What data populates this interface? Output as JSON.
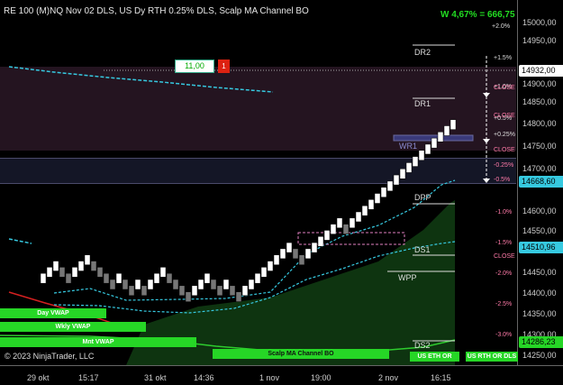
{
  "header": {
    "title": "RE 100 (M)NQ Nov 02 DLS, US Dy RTH 0.25% DLS, Scalp MA Channel BO",
    "pnl": "W 4,67% = 666,75"
  },
  "order": {
    "price": "11,00",
    "quantity": "1"
  },
  "price_axis": {
    "ticks": [
      "15000,00",
      "14950,00",
      "14900,00",
      "14850,00",
      "14800,00",
      "14750,00",
      "14700,00",
      "14650,00",
      "14600,00",
      "14550,00",
      "14500,00",
      "14450,00",
      "14400,00",
      "14350,00",
      "14300,00",
      "14250,00"
    ],
    "last_price": "14932,00",
    "box_1": "14668,60",
    "box_2": "14510,96",
    "box_3": "14286,23"
  },
  "percent_scale": {
    "upper": [
      "+2.0%",
      "+1.5%",
      "+1.0%",
      "+0.5%",
      "+0.25%",
      "-0.25%",
      "-0.5%"
    ],
    "lower": [
      "-1.0%",
      "-1.5%",
      "-2.0%",
      "-2.5%",
      "-3.0%"
    ],
    "close_label": "CLOSE"
  },
  "levels": {
    "dr2": "DR2",
    "dr1": "DR1",
    "wr1": "WR1",
    "dpp": "DPP",
    "ds1": "DS1",
    "wpp": "WPP",
    "ds2": "DS2"
  },
  "indicators": {
    "day_vwap": "Day VWAP",
    "wkly_vwap": "Wkly VWAP",
    "mnt_vwap": "Mnt VWAP",
    "scalp_channel": "Scalp MA Channel BO",
    "us_eth_or": "US ETH OR",
    "us_rth_or_dls": "US RTH OR DLS"
  },
  "time_axis": [
    "29 okt",
    "15:17",
    "31 okt",
    "14:36",
    "1 nov",
    "19:00",
    "2 nov",
    "16:15"
  ],
  "copyright": "© 2023 NinjaTrader, LLC",
  "colors": {
    "up_brick": "#ffffff",
    "down_brick": "#888888",
    "cyan_ma": "#36c9e0",
    "green_fill": "#0f3d12",
    "range_zone": "#2a1620",
    "pink": "#e080c0"
  }
}
